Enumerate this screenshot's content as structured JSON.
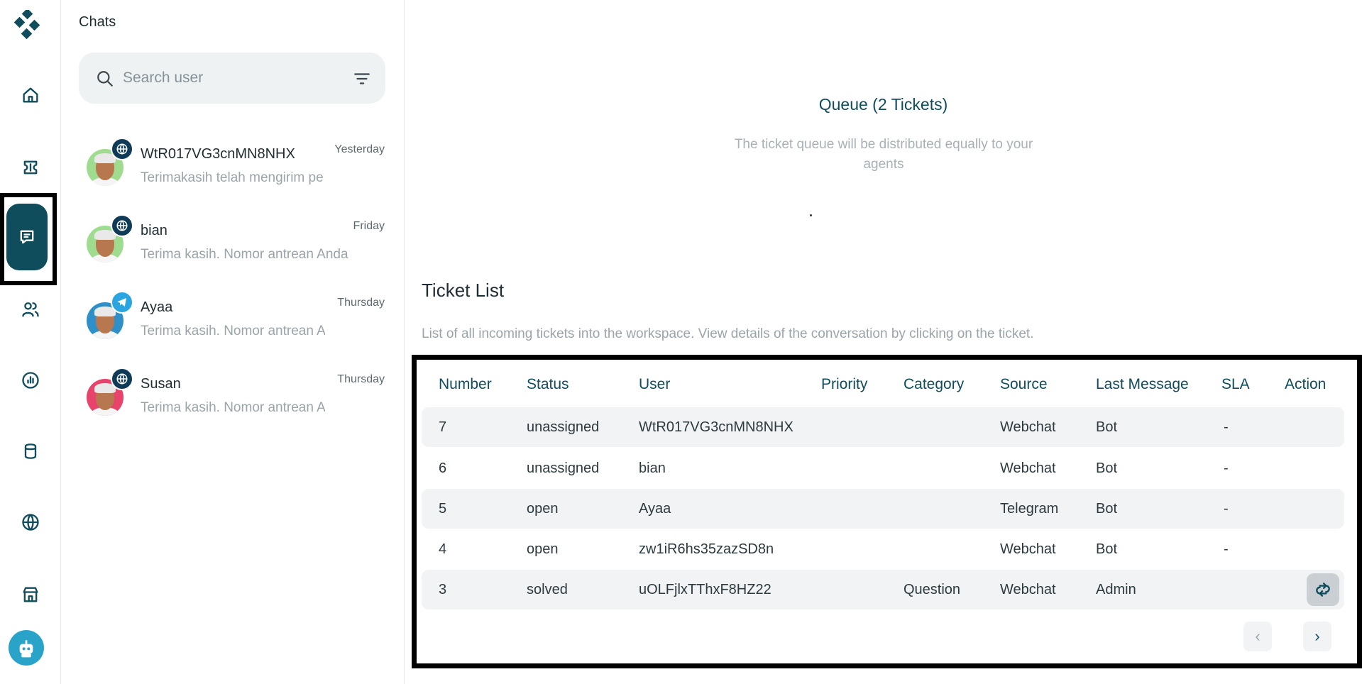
{
  "sidebar": {
    "items": [
      {
        "icon": "home-icon"
      },
      {
        "icon": "ticket-icon"
      },
      {
        "icon": "chat-icon",
        "active": true
      },
      {
        "icon": "users-icon"
      },
      {
        "icon": "analytics-icon"
      },
      {
        "icon": "database-icon"
      },
      {
        "icon": "globe-icon"
      },
      {
        "icon": "store-icon"
      }
    ],
    "accent": "#0f4c5c"
  },
  "chats": {
    "title": "Chats",
    "search_placeholder": "Search user",
    "items": [
      {
        "name": "WtR017VG3cnMN8NHX",
        "time": "Yesterday",
        "message": "Terimakasih telah mengirim pe",
        "channel": "globe-icon",
        "avatar_bg": "#9fdc8f"
      },
      {
        "name": "bian",
        "time": "Friday",
        "message": "Terima kasih. Nomor antrean Anda",
        "channel": "globe-icon",
        "avatar_bg": "#9fdc8f"
      },
      {
        "name": "Ayaa",
        "time": "Thursday",
        "message": "Terima kasih. Nomor antrean A",
        "channel": "telegram-icon",
        "avatar_bg": "#2f8fc8"
      },
      {
        "name": "Susan",
        "time": "Thursday",
        "message": "Terima kasih. Nomor antrean A",
        "channel": "globe-icon",
        "avatar_bg": "#e8436a"
      }
    ]
  },
  "queue": {
    "title": "Queue (2 Tickets)",
    "subtitle": "The ticket queue will be distributed equally to your agents"
  },
  "ticket_list": {
    "title": "Ticket List",
    "subtitle": "List of all incoming tickets into the workspace. View details of the conversation by clicking on the ticket.",
    "columns": [
      "Number",
      "Status",
      "User",
      "Priority",
      "Category",
      "Source",
      "Last Message",
      "SLA",
      "Action"
    ],
    "rows": [
      {
        "number": "7",
        "status": "unassigned",
        "user": "WtR017VG3cnMN8NHX",
        "priority": "",
        "category": "",
        "source": "Webchat",
        "last_message": "Bot",
        "sla": "-",
        "action": ""
      },
      {
        "number": "6",
        "status": "unassigned",
        "user": "bian",
        "priority": "",
        "category": "",
        "source": "Webchat",
        "last_message": "Bot",
        "sla": "-",
        "action": ""
      },
      {
        "number": "5",
        "status": "open",
        "user": "Ayaa",
        "priority": "",
        "category": "",
        "source": "Telegram",
        "last_message": "Bot",
        "sla": "-",
        "action": ""
      },
      {
        "number": "4",
        "status": "open",
        "user": "zw1iR6hs35zazSD8n",
        "priority": "",
        "category": "",
        "source": "Webchat",
        "last_message": "Bot",
        "sla": "-",
        "action": ""
      },
      {
        "number": "3",
        "status": "solved",
        "user": "uOLFjlxTThxF8HZ22",
        "priority": "",
        "category": "Question",
        "source": "Webchat",
        "last_message": "Admin",
        "sla": "",
        "action": "reopen-icon"
      }
    ],
    "pager": {
      "prev": "‹",
      "next": "›"
    }
  }
}
